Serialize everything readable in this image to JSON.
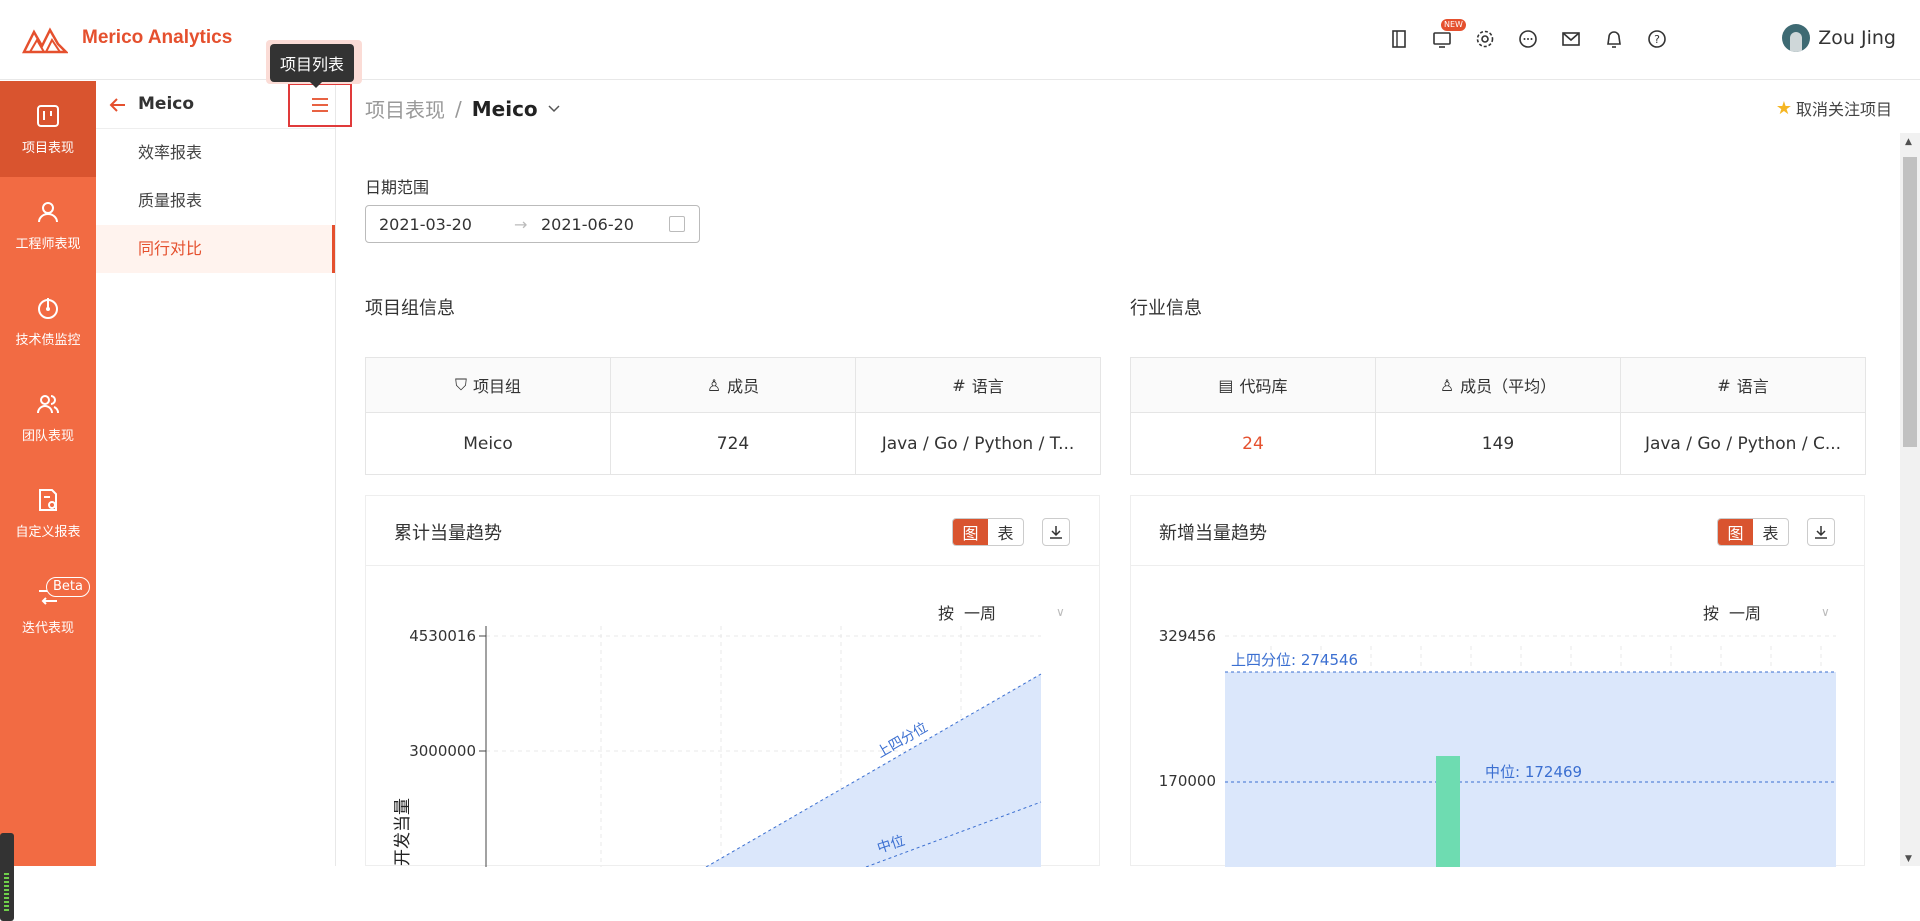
{
  "app": {
    "brand": "Merico Analytics"
  },
  "header": {
    "new_badge": "NEW",
    "username": "Zou Jing"
  },
  "rail": [
    {
      "label": "项目表现",
      "icon": "board-icon"
    },
    {
      "label": "工程师表现",
      "icon": "user-icon"
    },
    {
      "label": "技术债监控",
      "icon": "gauge-icon"
    },
    {
      "label": "团队表现",
      "icon": "team-icon"
    },
    {
      "label": "自定义报表",
      "icon": "report-icon"
    },
    {
      "label": "迭代表现",
      "icon": "iteration-icon",
      "badge": "Beta"
    }
  ],
  "sidebar": {
    "title": "Meico",
    "tooltip": "项目列表",
    "items": [
      {
        "label": "效率报表"
      },
      {
        "label": "质量报表"
      },
      {
        "label": "同行对比"
      }
    ]
  },
  "breadcrumb": {
    "parent": "项目表现",
    "separator": "/",
    "current": "Meico"
  },
  "follow": {
    "label": "取消关注项目"
  },
  "date": {
    "label": "日期范围",
    "start": "2021-03-20",
    "arrow": "→",
    "end": "2021-06-20"
  },
  "project_info": {
    "title": "项目组信息",
    "columns": [
      {
        "header": "项目组",
        "value": "Meico"
      },
      {
        "header": "成员",
        "value": "724"
      },
      {
        "header": "语言",
        "value": "Java / Go / Python / T..."
      }
    ]
  },
  "industry_info": {
    "title": "行业信息",
    "columns": [
      {
        "header": "代码库",
        "value": "24"
      },
      {
        "header": "成员（平均）",
        "value": "149"
      },
      {
        "header": "语言",
        "value": "Java / Go / Python / C..."
      }
    ]
  },
  "cards": [
    {
      "title": "累计当量趋势",
      "seg_chart": "图",
      "seg_table": "表",
      "period_prefix": "按",
      "period": "一周"
    },
    {
      "title": "新增当量趋势",
      "seg_chart": "图",
      "seg_table": "表",
      "period_prefix": "按",
      "period": "一周"
    }
  ],
  "chart_data": [
    {
      "type": "area",
      "title": "累计当量趋势",
      "ylabel": "开发当量",
      "y_ticks": [
        4530016,
        3000000
      ],
      "annotations": [
        "上四分位",
        "中位"
      ]
    },
    {
      "type": "bar",
      "title": "新增当量趋势",
      "y_ticks": [
        329456,
        170000
      ],
      "annotations": [
        "上四分位: 274546",
        "中位: 172469"
      ],
      "upper_quartile": 274546,
      "median": 172469
    }
  ],
  "colors": {
    "brand": "#e5502e",
    "rail": "#f26b43",
    "rail_active": "#d9542f",
    "band": "#dbe7fb",
    "line": "#3b6fd1",
    "bar": "#6edcb1"
  }
}
